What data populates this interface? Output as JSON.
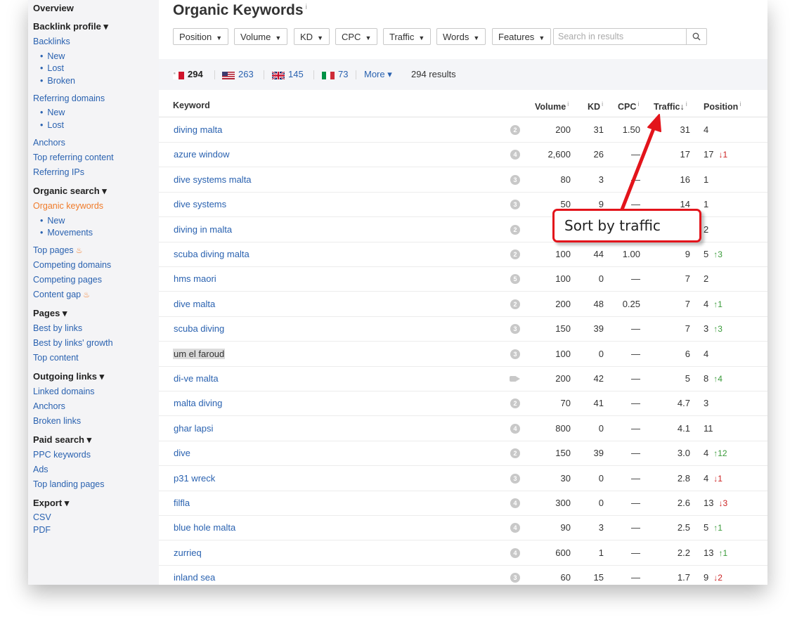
{
  "sidebar": {
    "items": [
      {
        "label": "Overview",
        "kind": "h"
      },
      {
        "label": "Backlink profile ▾",
        "kind": "h"
      },
      {
        "label": "Backlinks",
        "kind": "l"
      },
      {
        "label": "New",
        "kind": "s"
      },
      {
        "label": "Lost",
        "kind": "s"
      },
      {
        "label": "Broken",
        "kind": "s"
      },
      {
        "label": "Referring domains",
        "kind": "l"
      },
      {
        "label": "New",
        "kind": "s"
      },
      {
        "label": "Lost",
        "kind": "s"
      },
      {
        "label": "Anchors",
        "kind": "l"
      },
      {
        "label": "Top referring content",
        "kind": "l"
      },
      {
        "label": "Referring IPs",
        "kind": "l"
      },
      {
        "label": "Organic search ▾",
        "kind": "h"
      },
      {
        "label": "Organic keywords",
        "kind": "a"
      },
      {
        "label": "New",
        "kind": "s"
      },
      {
        "label": "Movements",
        "kind": "s"
      },
      {
        "label": "Top pages",
        "kind": "l"
      },
      {
        "label": "Competing domains",
        "kind": "l"
      },
      {
        "label": "Competing pages",
        "kind": "l"
      },
      {
        "label": "Content gap",
        "kind": "l"
      },
      {
        "label": "Pages ▾",
        "kind": "h"
      },
      {
        "label": "Best by links",
        "kind": "l"
      },
      {
        "label": "Best by links' growth",
        "kind": "l"
      },
      {
        "label": "Top content",
        "kind": "l"
      },
      {
        "label": "Outgoing links ▾",
        "kind": "h"
      },
      {
        "label": "Linked domains",
        "kind": "l"
      },
      {
        "label": "Anchors",
        "kind": "l"
      },
      {
        "label": "Broken links",
        "kind": "l"
      },
      {
        "label": "Paid search ▾",
        "kind": "h"
      },
      {
        "label": "PPC keywords",
        "kind": "l"
      },
      {
        "label": "Ads",
        "kind": "l"
      },
      {
        "label": "Top landing pages",
        "kind": "l"
      },
      {
        "label": "Export ▾",
        "kind": "h"
      },
      {
        "label": "CSV",
        "kind": "l"
      },
      {
        "label": "PDF",
        "kind": "l"
      }
    ]
  },
  "page": {
    "title": "Organic Keywords",
    "title_info": "i"
  },
  "filters": {
    "buttons": [
      "Position",
      "Volume",
      "KD",
      "CPC",
      "Traffic",
      "Words",
      "Features"
    ],
    "search_placeholder": "Search in results"
  },
  "countries": {
    "items": [
      {
        "code": "MT",
        "count": "294"
      },
      {
        "code": "US",
        "count": "263"
      },
      {
        "code": "GB",
        "count": "145"
      },
      {
        "code": "IT",
        "count": "73"
      }
    ],
    "more": "More ▾",
    "results": "294 results"
  },
  "table": {
    "headers": {
      "keyword": "Keyword",
      "volume": "Volume",
      "kd": "KD",
      "cpc": "CPC",
      "traffic": "Traffic",
      "position": "Position",
      "info": "i",
      "sort": "↓"
    },
    "rows": [
      {
        "kw": "diving malta",
        "sf": "2",
        "vol": "200",
        "kd": "31",
        "cpc": "1.50",
        "tr": "31",
        "pos": "4",
        "chg": "",
        "dir": ""
      },
      {
        "kw": "azure window",
        "sf": "4",
        "vol": "2,600",
        "kd": "26",
        "cpc": "—",
        "tr": "17",
        "pos": "17",
        "chg": "↓1",
        "dir": "down"
      },
      {
        "kw": "dive systems malta",
        "sf": "3",
        "vol": "80",
        "kd": "3",
        "cpc": "—",
        "tr": "16",
        "pos": "1",
        "chg": "",
        "dir": ""
      },
      {
        "kw": "dive systems",
        "sf": "3",
        "vol": "50",
        "kd": "9",
        "cpc": "—",
        "tr": "14",
        "pos": "1",
        "chg": "",
        "dir": ""
      },
      {
        "kw": "diving in malta",
        "sf": "2",
        "vol": "",
        "kd": "",
        "cpc": "",
        "tr": "",
        "pos": "2",
        "chg": "",
        "dir": ""
      },
      {
        "kw": "scuba diving malta",
        "sf": "2",
        "vol": "100",
        "kd": "44",
        "cpc": "1.00",
        "tr": "9",
        "pos": "5",
        "chg": "↑3",
        "dir": "up"
      },
      {
        "kw": "hms maori",
        "sf": "5",
        "vol": "100",
        "kd": "0",
        "cpc": "—",
        "tr": "7",
        "pos": "2",
        "chg": "",
        "dir": ""
      },
      {
        "kw": "dive malta",
        "sf": "2",
        "vol": "200",
        "kd": "48",
        "cpc": "0.25",
        "tr": "7",
        "pos": "4",
        "chg": "↑1",
        "dir": "up"
      },
      {
        "kw": "scuba diving",
        "sf": "3",
        "vol": "150",
        "kd": "39",
        "cpc": "—",
        "tr": "7",
        "pos": "3",
        "chg": "↑3",
        "dir": "up"
      },
      {
        "kw": "um el faroud",
        "sf": "3",
        "vol": "100",
        "kd": "0",
        "cpc": "—",
        "tr": "6",
        "pos": "4",
        "chg": "",
        "dir": "",
        "hl": true
      },
      {
        "kw": "di-ve malta",
        "sf": "video",
        "vol": "200",
        "kd": "42",
        "cpc": "—",
        "tr": "5",
        "pos": "8",
        "chg": "↑4",
        "dir": "up"
      },
      {
        "kw": "malta diving",
        "sf": "2",
        "vol": "70",
        "kd": "41",
        "cpc": "—",
        "tr": "4.7",
        "pos": "3",
        "chg": "",
        "dir": ""
      },
      {
        "kw": "ghar lapsi",
        "sf": "4",
        "vol": "800",
        "kd": "0",
        "cpc": "—",
        "tr": "4.1",
        "pos": "11",
        "chg": "",
        "dir": ""
      },
      {
        "kw": "dive",
        "sf": "2",
        "vol": "150",
        "kd": "39",
        "cpc": "—",
        "tr": "3.0",
        "pos": "4",
        "chg": "↑12",
        "dir": "up"
      },
      {
        "kw": "p31 wreck",
        "sf": "3",
        "vol": "30",
        "kd": "0",
        "cpc": "—",
        "tr": "2.8",
        "pos": "4",
        "chg": "↓1",
        "dir": "down"
      },
      {
        "kw": "filfla",
        "sf": "4",
        "vol": "300",
        "kd": "0",
        "cpc": "—",
        "tr": "2.6",
        "pos": "13",
        "chg": "↓3",
        "dir": "down"
      },
      {
        "kw": "blue hole malta",
        "sf": "4",
        "vol": "90",
        "kd": "3",
        "cpc": "—",
        "tr": "2.5",
        "pos": "5",
        "chg": "↑1",
        "dir": "up"
      },
      {
        "kw": "zurrieq",
        "sf": "4",
        "vol": "600",
        "kd": "1",
        "cpc": "—",
        "tr": "2.2",
        "pos": "13",
        "chg": "↑1",
        "dir": "up"
      },
      {
        "kw": "inland sea",
        "sf": "3",
        "vol": "60",
        "kd": "15",
        "cpc": "—",
        "tr": "1.7",
        "pos": "9",
        "chg": "↓2",
        "dir": "down"
      }
    ]
  },
  "annotation": {
    "text": "Sort by traffic",
    "color": "#e3141b"
  },
  "colors": {
    "link": "#2a62b0",
    "active": "#f07b2a",
    "up": "#3a9b3a",
    "down": "#cc2222"
  }
}
